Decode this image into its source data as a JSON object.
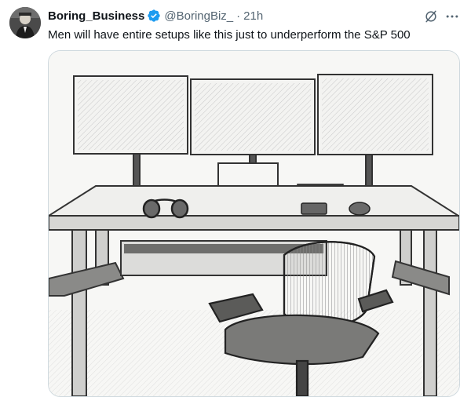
{
  "tweet": {
    "display_name": "Boring_Business",
    "handle": "@BoringBiz_",
    "separator": "·",
    "time": "21h",
    "text": "Men will have entire setups like this just to underperform the S&P 500",
    "verified": true,
    "icons": {
      "verified": "verified-badge-icon",
      "grok": "grok-icon",
      "more": "more-options-icon"
    },
    "colors": {
      "verified_badge": "#1d9bf0",
      "secondary_text": "#536471",
      "primary_text": "#0f1419",
      "media_border": "#cfd9de"
    }
  }
}
